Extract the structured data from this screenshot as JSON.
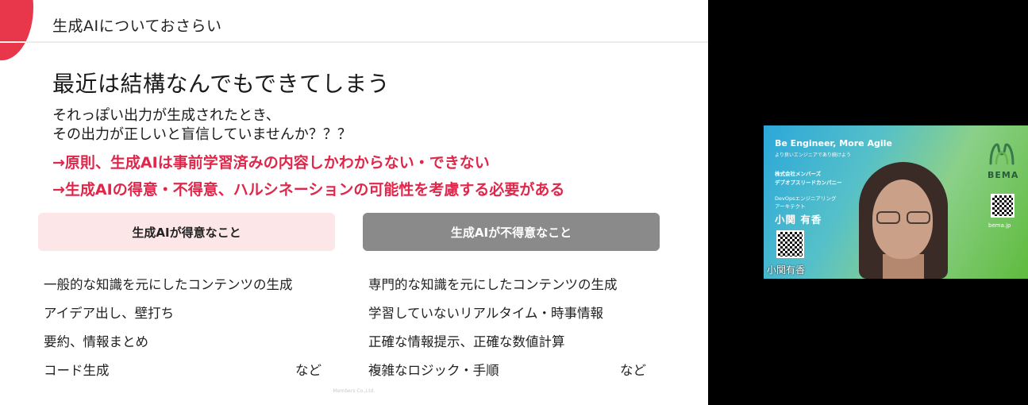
{
  "slide": {
    "section_title": "生成AIについておさらい",
    "headline": "最近は結構なんでもできてしまう",
    "body": [
      "それっぽい出力が生成されたとき、",
      "その出力が正しいと盲信していませんか？？？"
    ],
    "emphasis": [
      "→原則、生成AIは事前学習済みの内容しかわからない・できない",
      "→生成AIの得意・不得意、ハルシネーションの可能性を考慮する必要がある"
    ],
    "good": {
      "heading": "生成AIが得意なこと",
      "items": [
        "一般的な知識を元にしたコンテンツの生成",
        "アイデア出し、壁打ち",
        "要約、情報まとめ",
        "コード生成"
      ],
      "tail": "など"
    },
    "bad": {
      "heading": "生成AIが不得意なこと",
      "items": [
        "専門的な知識を元にしたコンテンツの生成",
        "学習していないリアルタイム・時事情報",
        "正確な情報提示、正確な数値計算",
        "複雑なロジック・手順"
      ],
      "tail": "など"
    },
    "footer": "Members Co.,Ltd.",
    "accent_color": "#e0264a",
    "good_bg": "#fde6e7",
    "bad_bg": "#8a8a8a"
  },
  "camera": {
    "tagline": "Be Engineer, More Agile",
    "tagline_sub": "より良いエンジニアであり続けよう",
    "company": "株式会社メンバーズ",
    "unit": "デブオプスリードカンパニー",
    "role1": "DevOpsエンジニアリング",
    "role2": "アーキテクト",
    "name": "小関 有香",
    "brand": "BEMA",
    "site": "bema.jp",
    "participant_label": "小関有香"
  }
}
